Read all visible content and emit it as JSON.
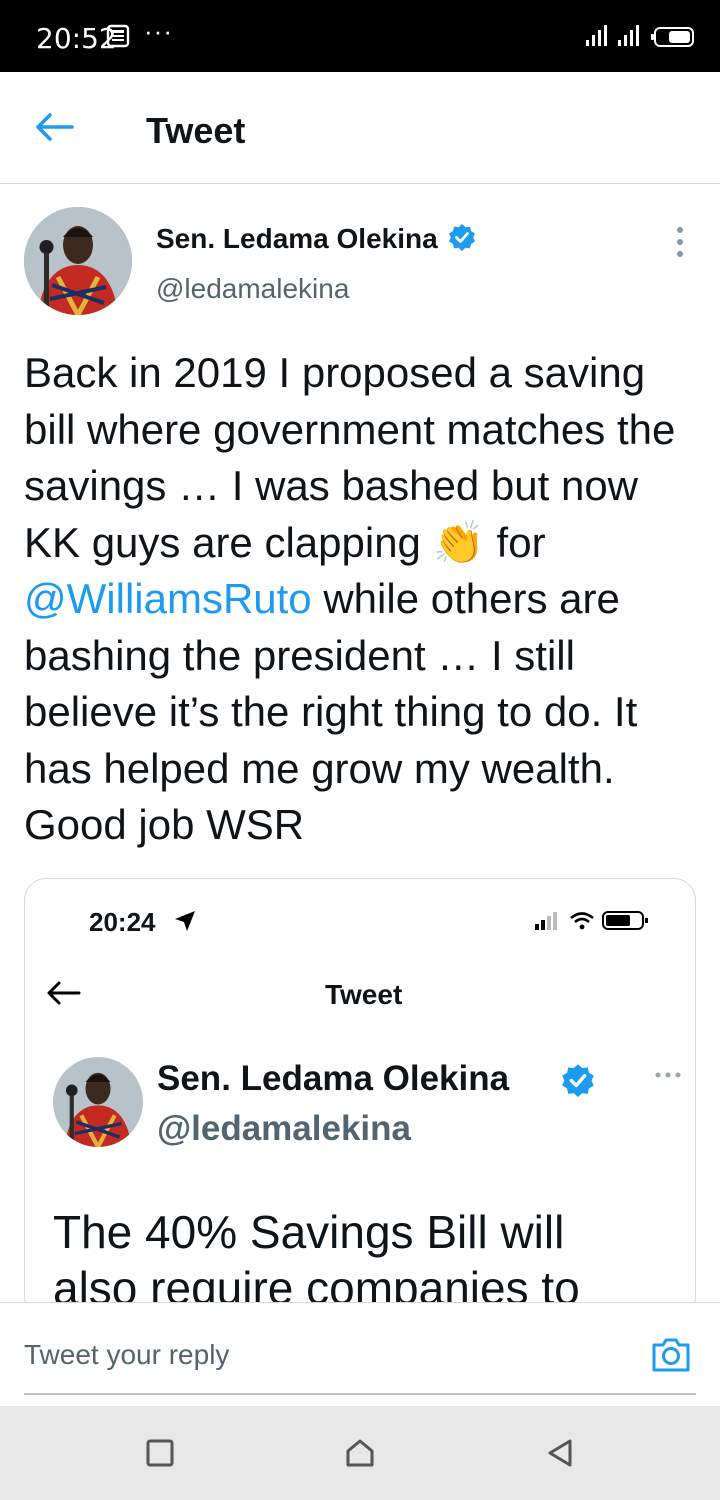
{
  "status_bar": {
    "time": "20:52",
    "dots": "···",
    "icons": [
      "news-icon",
      "signal-icon",
      "battery-icon"
    ]
  },
  "header": {
    "title": "Tweet",
    "back_icon": "arrow-left-icon"
  },
  "tweet": {
    "author_name": "Sen. Ledama Olekina",
    "handle": "@ledamalekina",
    "verified": true,
    "text_before_emoji": "Back in 2019 I proposed a saving bill where government matches the savings … I was bashed but now KK guys are clapping ",
    "emoji": "👏",
    "text_for": "for ",
    "mention": "@WilliamsRuto",
    "text_after": " while others are bashing the president … I still believe it’s the right thing to do. It has helped me grow my wealth. Good job WSR"
  },
  "embedded_screenshot": {
    "status_time": "20:24",
    "title": "Tweet",
    "author_name": "Sen. Ledama Olekina",
    "handle": "@ledamalekina",
    "text_line1": "The 40% Savings Bill will",
    "text_line2": "also require companies to"
  },
  "reply": {
    "placeholder": "Tweet your reply",
    "camera_icon": "camera-icon"
  },
  "nav": {
    "icons": [
      "recent-apps-icon",
      "home-icon",
      "back-icon"
    ]
  },
  "colors": {
    "accent": "#1d9bf0",
    "text": "#0f1419",
    "secondary": "#536471",
    "border": "#d6d9dc"
  }
}
